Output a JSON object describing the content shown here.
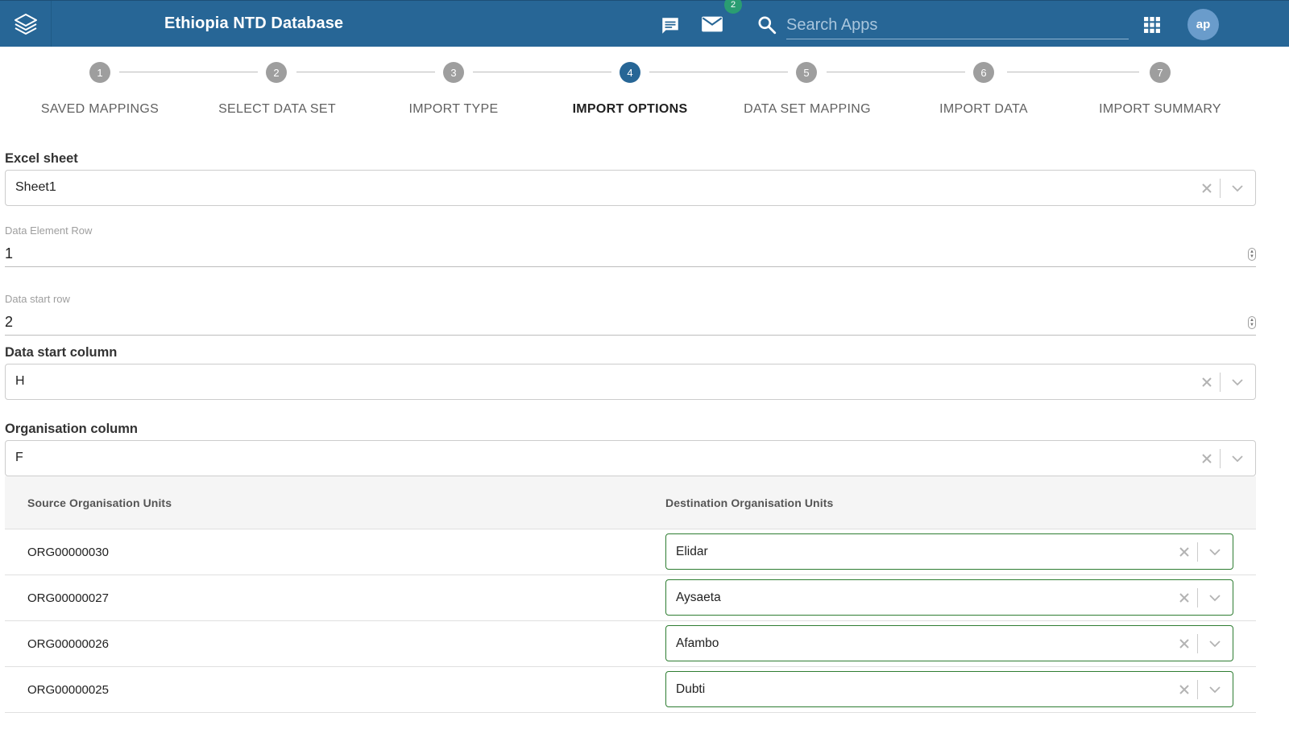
{
  "header": {
    "app_title": "Ethiopia NTD Database",
    "mail_badge_count": "2",
    "search_placeholder": "Search Apps",
    "avatar_initials": "ap",
    "icons": [
      "dhis2-logo-icon",
      "chat-icon",
      "mail-icon",
      "search-icon",
      "apps-grid-icon"
    ],
    "colors": {
      "bar": "#276696",
      "badge": "#2a9d72",
      "avatar": "#6a9ccb"
    }
  },
  "stepper": {
    "active_step": 4,
    "steps": [
      {
        "number": "1",
        "label": "SAVED MAPPINGS"
      },
      {
        "number": "2",
        "label": "SELECT DATA SET"
      },
      {
        "number": "3",
        "label": "IMPORT TYPE"
      },
      {
        "number": "4",
        "label": "IMPORT OPTIONS"
      },
      {
        "number": "5",
        "label": "DATA SET MAPPING"
      },
      {
        "number": "6",
        "label": "IMPORT DATA"
      },
      {
        "number": "7",
        "label": "IMPORT SUMMARY"
      }
    ]
  },
  "form": {
    "excel_sheet": {
      "label": "Excel sheet",
      "value": "Sheet1"
    },
    "data_element_row": {
      "label": "Data Element Row",
      "value": "1"
    },
    "data_start_row": {
      "label": "Data start row",
      "value": "2"
    },
    "data_start_column": {
      "label": "Data start column",
      "value": "H"
    },
    "organisation_column": {
      "label": "Organisation column",
      "value": "F"
    }
  },
  "org_table": {
    "headers": {
      "source": "Source Organisation Units",
      "destination": "Destination Organisation Units"
    },
    "rows": [
      {
        "source": "ORG00000030",
        "destination": "Elidar"
      },
      {
        "source": "ORG00000027",
        "destination": "Aysaeta"
      },
      {
        "source": "ORG00000026",
        "destination": "Afambo"
      },
      {
        "source": "ORG00000025",
        "destination": "Dubti"
      }
    ],
    "mapped_border_color": "#2e7d32"
  }
}
